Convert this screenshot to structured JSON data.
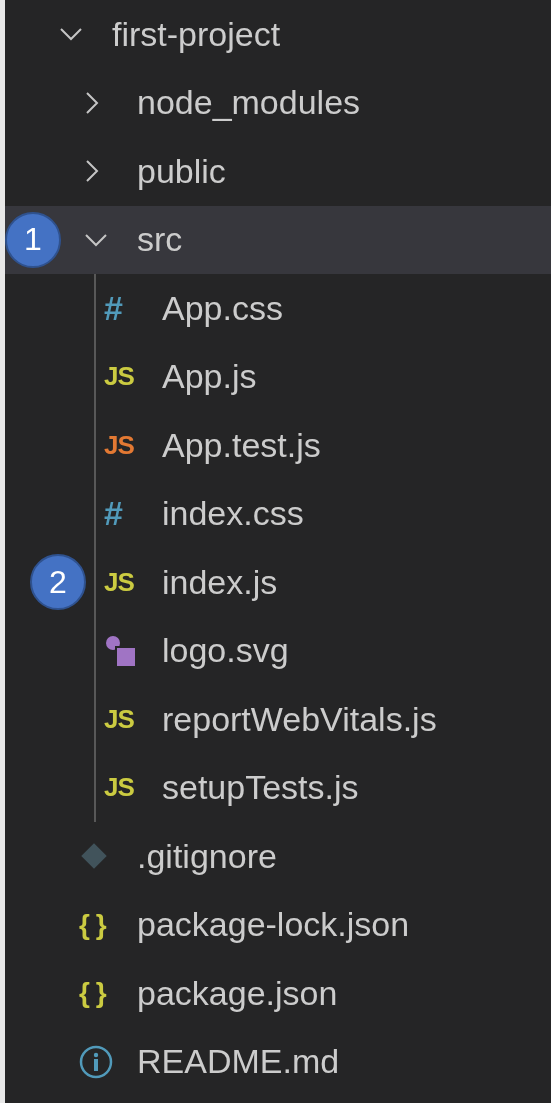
{
  "explorer": {
    "tree": [
      {
        "kind": "folder",
        "label": "first-project",
        "expanded": true,
        "selected": false,
        "children": [
          {
            "kind": "folder",
            "label": "node_modules",
            "expanded": false,
            "selected": false
          },
          {
            "kind": "folder",
            "label": "public",
            "expanded": false,
            "selected": false
          },
          {
            "kind": "folder",
            "label": "src",
            "expanded": true,
            "selected": true,
            "badge": "1",
            "children": [
              {
                "kind": "css",
                "glyph": "#",
                "label": "App.css",
                "selected": false
              },
              {
                "kind": "js",
                "glyph": "JS",
                "label": "App.js",
                "selected": false
              },
              {
                "kind": "test",
                "glyph": "JS",
                "label": "App.test.js",
                "selected": false
              },
              {
                "kind": "css",
                "glyph": "#",
                "label": "index.css",
                "selected": false
              },
              {
                "kind": "js",
                "glyph": "JS",
                "label": "index.js",
                "selected": false,
                "badge": "2"
              },
              {
                "kind": "svg",
                "label": "logo.svg",
                "selected": false
              },
              {
                "kind": "js",
                "glyph": "JS",
                "label": "reportWebVitals.js",
                "selected": false
              },
              {
                "kind": "js",
                "glyph": "JS",
                "label": "setupTests.js",
                "selected": false
              }
            ]
          },
          {
            "kind": "git",
            "label": ".gitignore",
            "selected": false
          },
          {
            "kind": "json",
            "glyph": "{ }",
            "label": "package-lock.json",
            "selected": false
          },
          {
            "kind": "json",
            "glyph": "{ }",
            "label": "package.json",
            "selected": false
          },
          {
            "kind": "info",
            "label": "README.md",
            "selected": false
          }
        ]
      }
    ]
  }
}
